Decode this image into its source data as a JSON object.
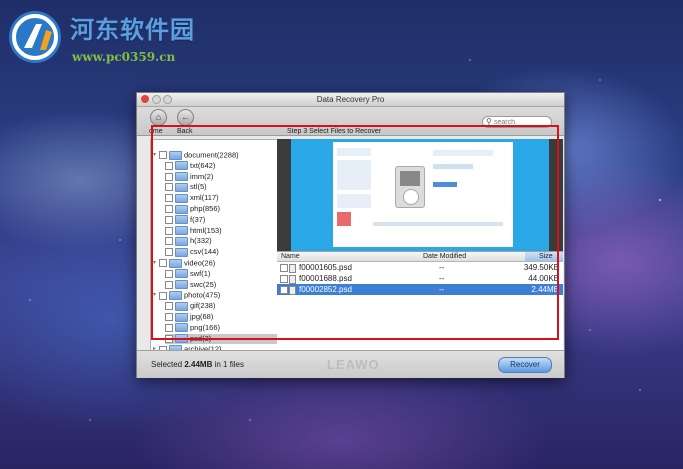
{
  "watermark": {
    "title": "河东软件园",
    "url": "www.pc0359.cn"
  },
  "window": {
    "title": "Data Recovery Pro"
  },
  "toolbar": {
    "home_label": "ome",
    "back_label": "Back",
    "step_title": "Step 3 Select Files to Recover",
    "search_placeholder": "search"
  },
  "tree": {
    "items": [
      {
        "label": "document(2288)",
        "level": 0
      },
      {
        "label": "txt(642)",
        "level": 1
      },
      {
        "label": "imm(2)",
        "level": 1
      },
      {
        "label": "stl(5)",
        "level": 1
      },
      {
        "label": "xml(117)",
        "level": 1
      },
      {
        "label": "php(856)",
        "level": 1
      },
      {
        "label": "f(37)",
        "level": 1
      },
      {
        "label": "html(153)",
        "level": 1
      },
      {
        "label": "h(332)",
        "level": 1
      },
      {
        "label": "csv(144)",
        "level": 1
      },
      {
        "label": "video(26)",
        "level": 0
      },
      {
        "label": "swf(1)",
        "level": 1
      },
      {
        "label": "swc(25)",
        "level": 1
      },
      {
        "label": "photo(475)",
        "level": 0
      },
      {
        "label": "gif(238)",
        "level": 1
      },
      {
        "label": "jpg(68)",
        "level": 1
      },
      {
        "label": "png(166)",
        "level": 1
      },
      {
        "label": "psd(3)",
        "level": 1,
        "selected": true
      },
      {
        "label": "archive(12)",
        "level": 0
      }
    ]
  },
  "list": {
    "headers": {
      "name": "Name",
      "date": "Date Modified",
      "size": "Size"
    },
    "rows": [
      {
        "name": "f00001605.psd",
        "date": "--",
        "size": "349.50KB"
      },
      {
        "name": "f00001688.psd",
        "date": "--",
        "size": "44.00KB"
      },
      {
        "name": "f00002852.psd",
        "date": "--",
        "size": "2.44MB",
        "selected": true
      }
    ]
  },
  "status": {
    "prefix": "Selected ",
    "size": "2.44MB",
    "suffix": " in 1 files"
  },
  "brand": "LEAWO",
  "recover_label": "Recover",
  "colors": {
    "highlight": "#d8101a",
    "selection": "#3e7fd6",
    "accent": "#2aa7e6"
  }
}
